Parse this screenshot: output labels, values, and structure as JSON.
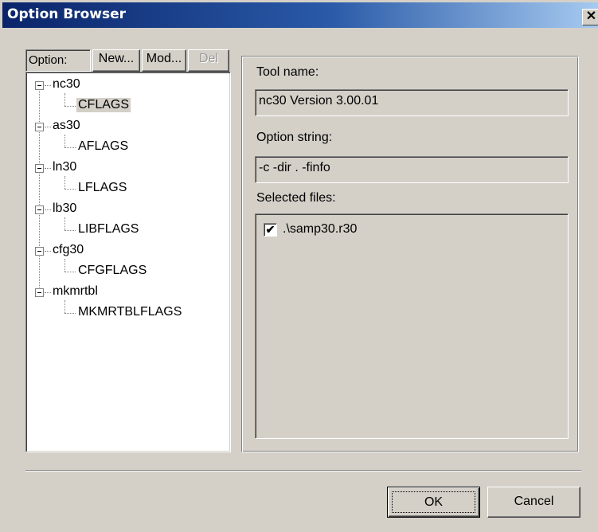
{
  "window": {
    "title": "Option Browser",
    "close_glyph": "✕"
  },
  "option_bar": {
    "label": "Option:",
    "new_label": "New...",
    "modify_label": "Mod...",
    "delete_label": "Del"
  },
  "tree": [
    {
      "label": "nc30",
      "expanded": true,
      "child": "CFLAGS",
      "child_selected": true
    },
    {
      "label": "as30",
      "expanded": true,
      "child": "AFLAGS",
      "child_selected": false
    },
    {
      "label": "ln30",
      "expanded": true,
      "child": "LFLAGS",
      "child_selected": false
    },
    {
      "label": "lb30",
      "expanded": true,
      "child": "LIBFLAGS",
      "child_selected": false
    },
    {
      "label": "cfg30",
      "expanded": true,
      "child": "CFGFLAGS",
      "child_selected": false
    },
    {
      "label": "mkmrtbl",
      "expanded": true,
      "child": "MKMRTBLFLAGS",
      "child_selected": false
    }
  ],
  "details": {
    "tool_name_label": "Tool name:",
    "tool_name_value": "nc30 Version 3.00.01",
    "option_string_label": "Option string:",
    "option_string_value": "-c -dir . -finfo",
    "selected_files_label": "Selected files:",
    "files": [
      {
        "name": ".\\samp30.r30",
        "checked": true
      }
    ]
  },
  "buttons": {
    "ok_label": "OK",
    "cancel_label": "Cancel"
  },
  "colors": {
    "face": "#d4d0c8",
    "title_start": "#0a246a",
    "title_end": "#a6caf0"
  },
  "icons": {
    "close": "close-icon",
    "check": "check-icon",
    "collapse": "collapse-icon"
  }
}
